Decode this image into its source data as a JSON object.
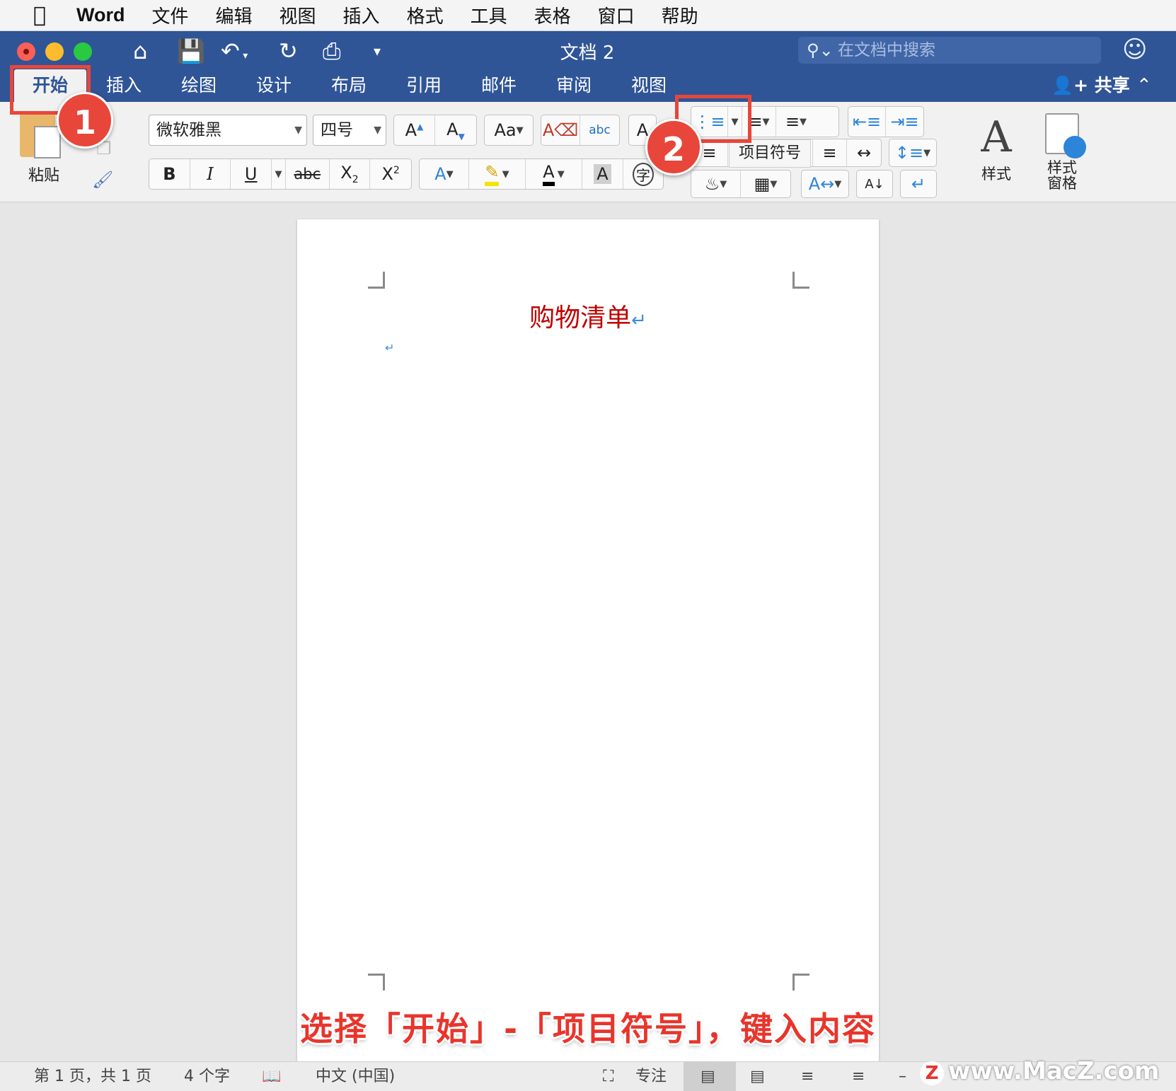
{
  "menubar": {
    "app": "Word",
    "items": [
      "文件",
      "编辑",
      "视图",
      "插入",
      "格式",
      "工具",
      "表格",
      "窗口",
      "帮助"
    ]
  },
  "window": {
    "title": "文档 2",
    "search_placeholder": "在文档中搜索",
    "share_label": "共享"
  },
  "ribbon_tabs": [
    "开始",
    "插入",
    "绘图",
    "设计",
    "布局",
    "引用",
    "邮件",
    "审阅",
    "视图"
  ],
  "home_ribbon": {
    "paste_label": "粘贴",
    "font_name": "微软雅黑",
    "font_size": "四号",
    "tooltip": "项目符号",
    "styles_label": "样式",
    "styles_pane_label_1": "样式",
    "styles_pane_label_2": "窗格"
  },
  "annotations": {
    "badge_1": "1",
    "badge_2": "2",
    "caption": "选择「开始」-「项目符号」，键入内容"
  },
  "document": {
    "heading": "购物清单"
  },
  "statusbar": {
    "page_info": "第 1 页，共 1 页",
    "word_count": "4 个字",
    "language": "中文 (中国)",
    "focus_label": "专注"
  },
  "watermark": "www.MacZ.com",
  "colors": {
    "title_bar": "#2f5597",
    "highlight": "#e8463a",
    "heading_text": "#c00000",
    "paragraph_mark": "#3b8fd9"
  }
}
